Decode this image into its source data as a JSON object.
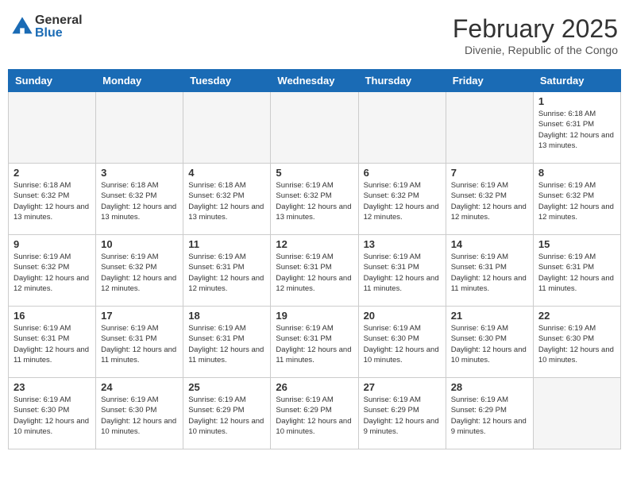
{
  "header": {
    "logo_general": "General",
    "logo_blue": "Blue",
    "month_title": "February 2025",
    "location": "Divenie, Republic of the Congo"
  },
  "weekdays": [
    "Sunday",
    "Monday",
    "Tuesday",
    "Wednesday",
    "Thursday",
    "Friday",
    "Saturday"
  ],
  "weeks": [
    [
      {
        "day": "",
        "info": ""
      },
      {
        "day": "",
        "info": ""
      },
      {
        "day": "",
        "info": ""
      },
      {
        "day": "",
        "info": ""
      },
      {
        "day": "",
        "info": ""
      },
      {
        "day": "",
        "info": ""
      },
      {
        "day": "1",
        "info": "Sunrise: 6:18 AM\nSunset: 6:31 PM\nDaylight: 12 hours\nand 13 minutes."
      }
    ],
    [
      {
        "day": "2",
        "info": "Sunrise: 6:18 AM\nSunset: 6:32 PM\nDaylight: 12 hours\nand 13 minutes."
      },
      {
        "day": "3",
        "info": "Sunrise: 6:18 AM\nSunset: 6:32 PM\nDaylight: 12 hours\nand 13 minutes."
      },
      {
        "day": "4",
        "info": "Sunrise: 6:18 AM\nSunset: 6:32 PM\nDaylight: 12 hours\nand 13 minutes."
      },
      {
        "day": "5",
        "info": "Sunrise: 6:19 AM\nSunset: 6:32 PM\nDaylight: 12 hours\nand 13 minutes."
      },
      {
        "day": "6",
        "info": "Sunrise: 6:19 AM\nSunset: 6:32 PM\nDaylight: 12 hours\nand 12 minutes."
      },
      {
        "day": "7",
        "info": "Sunrise: 6:19 AM\nSunset: 6:32 PM\nDaylight: 12 hours\nand 12 minutes."
      },
      {
        "day": "8",
        "info": "Sunrise: 6:19 AM\nSunset: 6:32 PM\nDaylight: 12 hours\nand 12 minutes."
      }
    ],
    [
      {
        "day": "9",
        "info": "Sunrise: 6:19 AM\nSunset: 6:32 PM\nDaylight: 12 hours\nand 12 minutes."
      },
      {
        "day": "10",
        "info": "Sunrise: 6:19 AM\nSunset: 6:32 PM\nDaylight: 12 hours\nand 12 minutes."
      },
      {
        "day": "11",
        "info": "Sunrise: 6:19 AM\nSunset: 6:31 PM\nDaylight: 12 hours\nand 12 minutes."
      },
      {
        "day": "12",
        "info": "Sunrise: 6:19 AM\nSunset: 6:31 PM\nDaylight: 12 hours\nand 12 minutes."
      },
      {
        "day": "13",
        "info": "Sunrise: 6:19 AM\nSunset: 6:31 PM\nDaylight: 12 hours\nand 11 minutes."
      },
      {
        "day": "14",
        "info": "Sunrise: 6:19 AM\nSunset: 6:31 PM\nDaylight: 12 hours\nand 11 minutes."
      },
      {
        "day": "15",
        "info": "Sunrise: 6:19 AM\nSunset: 6:31 PM\nDaylight: 12 hours\nand 11 minutes."
      }
    ],
    [
      {
        "day": "16",
        "info": "Sunrise: 6:19 AM\nSunset: 6:31 PM\nDaylight: 12 hours\nand 11 minutes."
      },
      {
        "day": "17",
        "info": "Sunrise: 6:19 AM\nSunset: 6:31 PM\nDaylight: 12 hours\nand 11 minutes."
      },
      {
        "day": "18",
        "info": "Sunrise: 6:19 AM\nSunset: 6:31 PM\nDaylight: 12 hours\nand 11 minutes."
      },
      {
        "day": "19",
        "info": "Sunrise: 6:19 AM\nSunset: 6:31 PM\nDaylight: 12 hours\nand 11 minutes."
      },
      {
        "day": "20",
        "info": "Sunrise: 6:19 AM\nSunset: 6:30 PM\nDaylight: 12 hours\nand 10 minutes."
      },
      {
        "day": "21",
        "info": "Sunrise: 6:19 AM\nSunset: 6:30 PM\nDaylight: 12 hours\nand 10 minutes."
      },
      {
        "day": "22",
        "info": "Sunrise: 6:19 AM\nSunset: 6:30 PM\nDaylight: 12 hours\nand 10 minutes."
      }
    ],
    [
      {
        "day": "23",
        "info": "Sunrise: 6:19 AM\nSunset: 6:30 PM\nDaylight: 12 hours\nand 10 minutes."
      },
      {
        "day": "24",
        "info": "Sunrise: 6:19 AM\nSunset: 6:30 PM\nDaylight: 12 hours\nand 10 minutes."
      },
      {
        "day": "25",
        "info": "Sunrise: 6:19 AM\nSunset: 6:29 PM\nDaylight: 12 hours\nand 10 minutes."
      },
      {
        "day": "26",
        "info": "Sunrise: 6:19 AM\nSunset: 6:29 PM\nDaylight: 12 hours\nand 10 minutes."
      },
      {
        "day": "27",
        "info": "Sunrise: 6:19 AM\nSunset: 6:29 PM\nDaylight: 12 hours\nand 9 minutes."
      },
      {
        "day": "28",
        "info": "Sunrise: 6:19 AM\nSunset: 6:29 PM\nDaylight: 12 hours\nand 9 minutes."
      },
      {
        "day": "",
        "info": ""
      }
    ]
  ]
}
